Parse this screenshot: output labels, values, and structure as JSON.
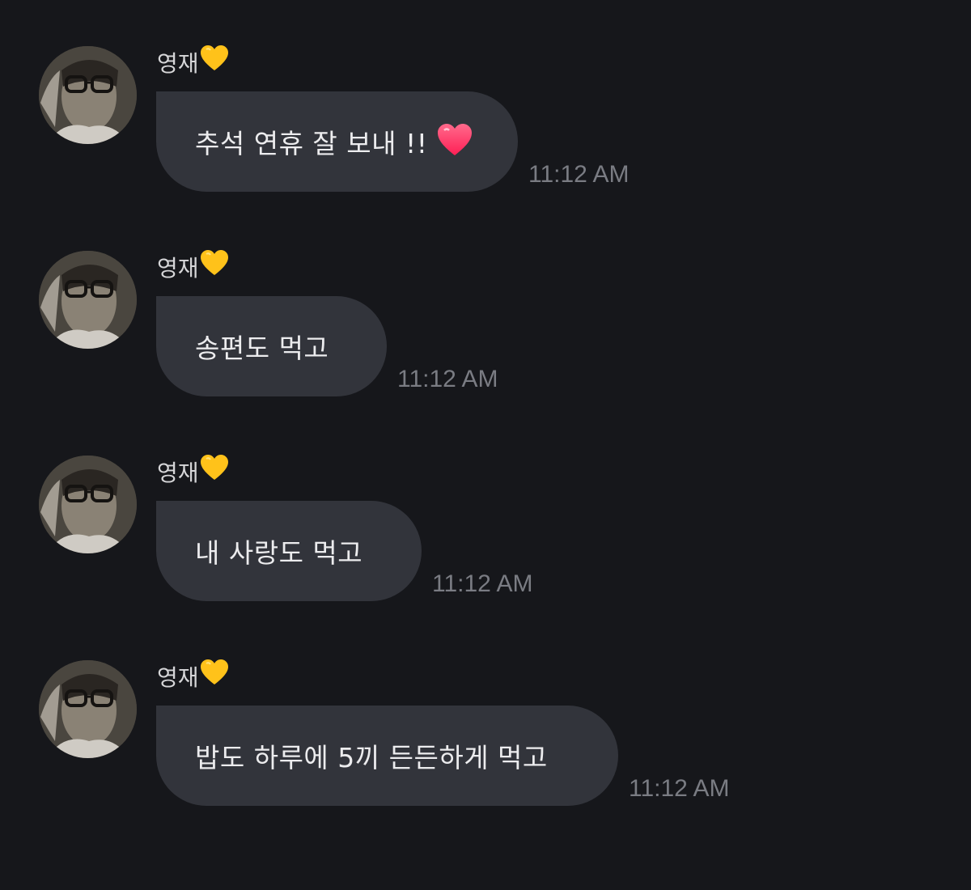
{
  "messages": [
    {
      "sender": "영재",
      "sender_emoji": "yellow-heart",
      "text": "추석 연휴 잘 보내 !!",
      "trailing_emoji": "red-heart",
      "time": "11:12 AM"
    },
    {
      "sender": "영재",
      "sender_emoji": "yellow-heart",
      "text": "송편도 먹고",
      "time": "11:12 AM"
    },
    {
      "sender": "영재",
      "sender_emoji": "yellow-heart",
      "text": "내 사랑도 먹고",
      "time": "11:12 AM"
    },
    {
      "sender": "영재",
      "sender_emoji": "yellow-heart",
      "text": "밥도 하루에 5끼 든든하게 먹고",
      "time": "11:12 AM"
    }
  ],
  "colors": {
    "background": "#16171b",
    "bubble": "#32343b",
    "text": "#ececee",
    "time": "#7a7c83",
    "sender_heart": "#ffc21a",
    "message_heart": "#ff2f6a"
  }
}
